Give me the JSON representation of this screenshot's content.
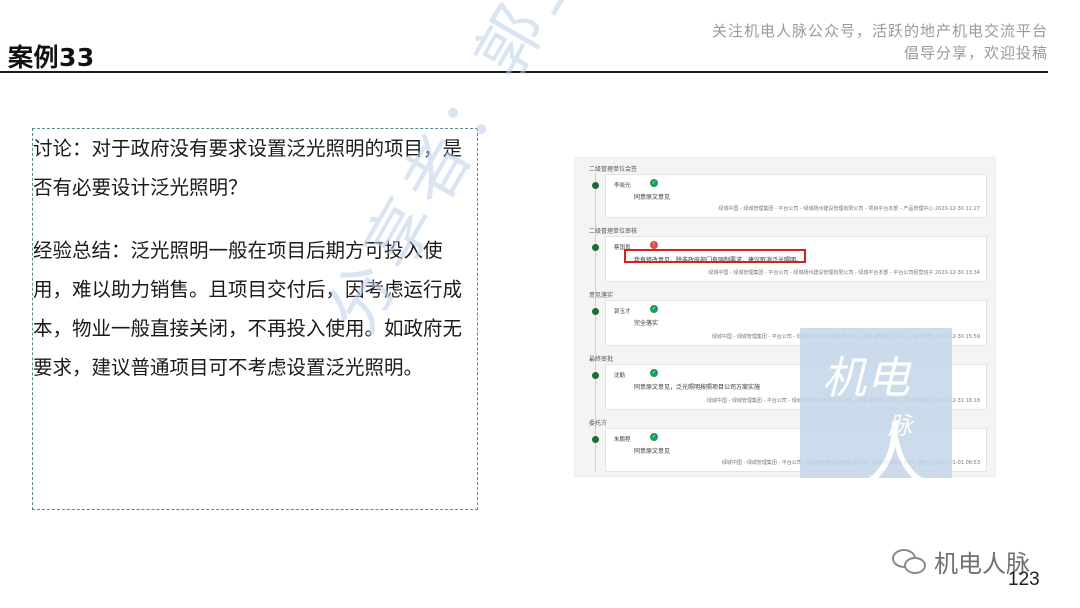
{
  "slide": {
    "title": "案例33",
    "header_note_line1": "关注机电人脉公众号，活跃的地产机电交流平台",
    "header_note_line2": "倡导分享，欢迎投稿",
    "page_number": "123"
  },
  "discussion": {
    "question": "讨论：对于政府没有要求设置泛光照明的项目，是否有必要设计泛光照明？",
    "summary": "经验总结：泛光照明一般在项目后期方可投入使用，难以助力销售。且项目交付后，因考虑运行成本，物业一般直接关闭，不再投入使用。如政府无要求，建议普通项目可不考虑设置泛光照明。"
  },
  "watermark": {
    "sharer_text": "分享者：郭玉才",
    "logo_line1": "机电",
    "logo_line2": "人",
    "logo_line3": "脉"
  },
  "approval_screenshot": {
    "sections": [
      {
        "label": "二级管理单位会签",
        "person": "李晓光",
        "status": "approved",
        "comment": "同意原文意见",
        "meta": "绿城中国 - 绿城管理集团 - 平台公司 - 绿城杨州建设管理有限公司 - 项目平台本部 - 产品管理中心   2020-12-30 11:27"
      },
      {
        "label": "二级管理单位审核",
        "person": "蔡国良",
        "status": "rejected",
        "comment": "我有修改意见。除非政府部门有强制要求，建议取消泛光照明。",
        "meta": "绿城中国 - 绿城管理集团 - 平台公司 - 绿城杨州建设管理有限公司 - 绿城平台本部 - 平台公司经营班子   2020-12-30 13:34"
      },
      {
        "label": "意见落实",
        "person": "郭玉才",
        "status": "approved",
        "comment": "完全落实",
        "meta": "绿城中国 - 绿城管理集团 - 平台公司 - 绿城杨州建设管理有限公司 - 绿城·咸阳春江花月 - 工程管理部   2020-12-30 15:59"
      },
      {
        "label": "最终审批",
        "person": "沈勤",
        "status": "approved",
        "comment": "同意原文意见，泛光照明按照项目公司方案实施",
        "meta": "绿城中国 - 绿城管理集团 - 平台公司 - 绿城杨州建设管理有限公司 - 绿城·咸阳春江花月 - 项目经营班子   2020-12-31 16:18"
      },
      {
        "label": "委托方",
        "person": "朱鹏程",
        "status": "approved",
        "comment": "同意原文意见",
        "meta": "绿城中国 - 绿城管理集团 - 平台公司 - 绿城杨州建设管理有限公司 - 绿城·咸阳春江花月 - 委托方   2021-01-01 08:53"
      }
    ]
  },
  "wechat": {
    "icon": "wechat-icon",
    "account_name": "机电人脉"
  }
}
